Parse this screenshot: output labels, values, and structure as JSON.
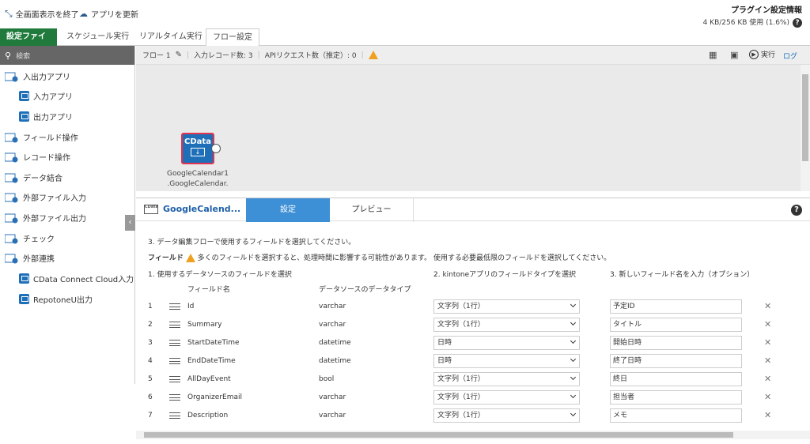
{
  "topbar": {
    "exit_fullscreen": "全画面表示を終了",
    "update_app": "アプリを更新",
    "plugin_info_title": "プラグイン設定情報",
    "plugin_info_usage": "4 KB/256 KB 使用 (1.6%)"
  },
  "tabs": [
    {
      "label": "設定ファイル"
    },
    {
      "label": "スケジュール実行"
    },
    {
      "label": "リアルタイム実行"
    },
    {
      "label": "フロー設定"
    }
  ],
  "sidebar": {
    "search_placeholder": "検索",
    "items": [
      {
        "label": "入出力アプリ"
      },
      {
        "label": "入力アプリ"
      },
      {
        "label": "出力アプリ"
      },
      {
        "label": "フィールド操作"
      },
      {
        "label": "レコード操作"
      },
      {
        "label": "データ結合"
      },
      {
        "label": "外部ファイル入力"
      },
      {
        "label": "外部ファイル出力"
      },
      {
        "label": "チェック"
      },
      {
        "label": "外部連携"
      },
      {
        "label": "CData Connect Cloud入力"
      },
      {
        "label": "RepotoneU出力"
      }
    ]
  },
  "flowbar": {
    "flow_name": "フロー 1",
    "input_records": "入力レコード数: 3",
    "api_requests": "APIリクエスト数（推定）: 0",
    "run_label": "実行",
    "log_label": "ログ"
  },
  "node": {
    "badge": "CData",
    "label_line1": "GoogleCalendar1",
    "label_line2": ".GoogleCalendar."
  },
  "panel": {
    "source_badge": "CData",
    "title": "GoogleCalend...",
    "tab_settings": "設定",
    "tab_preview": "プレビュー",
    "instruction": "3. データ編集フローで使用するフィールドを選択してください。",
    "fields_label": "フィールド",
    "fields_warning": "多くのフィールドを選択すると、処理時間に影響する可能性があります。 使用する必要最低限のフィールドを選択してください。",
    "col1_header": "1. 使用するデータソースのフィールドを選択",
    "col2_header": "2. kintoneアプリのフィールドタイプを選択",
    "col3_header": "3. 新しいフィールド名を入力（オプション）",
    "sub_field_name": "フィールド名",
    "sub_data_type": "データソースのデータタイプ",
    "rows": [
      {
        "num": "1",
        "field": "Id",
        "dtype": "varchar",
        "ktype": "文字列（1行）",
        "newname": "予定ID"
      },
      {
        "num": "2",
        "field": "Summary",
        "dtype": "varchar",
        "ktype": "文字列（1行）",
        "newname": "タイトル"
      },
      {
        "num": "3",
        "field": "StartDateTime",
        "dtype": "datetime",
        "ktype": "日時",
        "newname": "開始日時"
      },
      {
        "num": "4",
        "field": "EndDateTime",
        "dtype": "datetime",
        "ktype": "日時",
        "newname": "終了日時"
      },
      {
        "num": "5",
        "field": "AllDayEvent",
        "dtype": "bool",
        "ktype": "文字列（1行）",
        "newname": "終日"
      },
      {
        "num": "6",
        "field": "OrganizerEmail",
        "dtype": "varchar",
        "ktype": "文字列（1行）",
        "newname": "担当者"
      },
      {
        "num": "7",
        "field": "Description",
        "dtype": "varchar",
        "ktype": "文字列（1行）",
        "newname": "メモ"
      }
    ]
  },
  "colors": {
    "brand_green": "#1f7a3b",
    "accent_blue": "#3d8fd6",
    "node_blue": "#1e6fb8",
    "warning": "#f0a020"
  }
}
